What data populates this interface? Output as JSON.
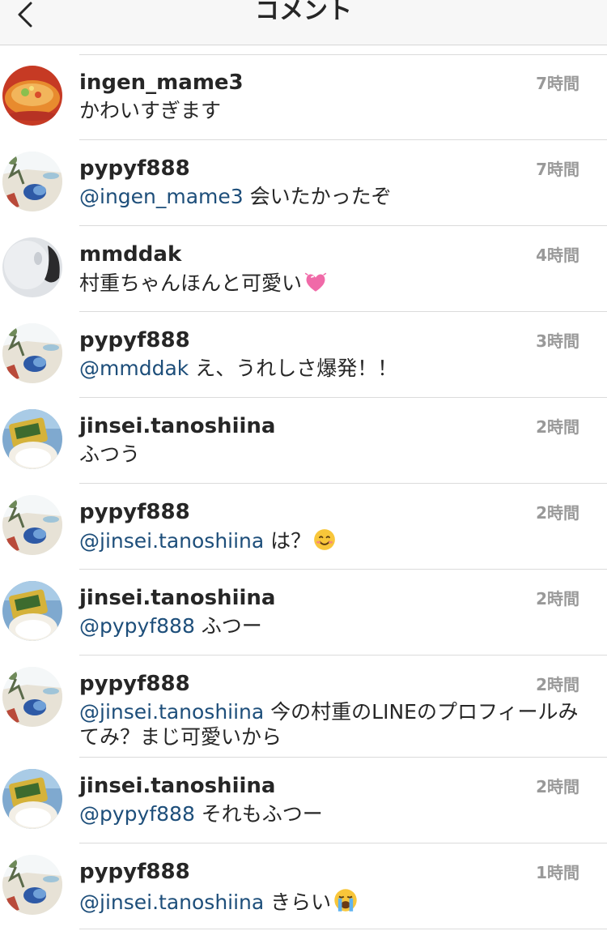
{
  "header": {
    "title": "コメント",
    "back_icon": "chevron-left-icon"
  },
  "comments": [
    {
      "username": "ingen_mame3",
      "time": "7時間",
      "mention": "",
      "text": "かわいすぎます",
      "emoji": "",
      "avatar": "food-photo"
    },
    {
      "username": "pypyf888",
      "time": "7時間",
      "mention": "@ingen_mame3",
      "text": " 会いたかったぞ",
      "emoji": "",
      "avatar": "beach-photo"
    },
    {
      "username": "mmddak",
      "time": "4時間",
      "mention": "",
      "text": "村重ちゃんほんと可愛い",
      "emoji": "sparkling-heart-emoji",
      "avatar": "grey-photo"
    },
    {
      "username": "pypyf888",
      "time": "3時間",
      "mention": "@mmddak",
      "text": " え、うれしさ爆発！！",
      "emoji": "",
      "avatar": "beach-photo"
    },
    {
      "username": "jinsei.tanoshiina",
      "time": "2時間",
      "mention": "",
      "text": "ふつう",
      "emoji": "",
      "avatar": "snack-photo"
    },
    {
      "username": "pypyf888",
      "time": "2時間",
      "mention": "@jinsei.tanoshiina",
      "text": " は？",
      "emoji": "smiling-face-emoji",
      "avatar": "beach-photo"
    },
    {
      "username": "jinsei.tanoshiina",
      "time": "2時間",
      "mention": "@pypyf888",
      "text": " ふつー",
      "emoji": "",
      "avatar": "snack-photo"
    },
    {
      "username": "pypyf888",
      "time": "2時間",
      "mention": "@jinsei.tanoshiina",
      "text": " 今の村重のLINEのプロフィールみてみ？まじ可愛いから",
      "emoji": "",
      "avatar": "beach-photo"
    },
    {
      "username": "jinsei.tanoshiina",
      "time": "2時間",
      "mention": "@pypyf888",
      "text": " それもふつー",
      "emoji": "",
      "avatar": "snack-photo"
    },
    {
      "username": "pypyf888",
      "time": "1時間",
      "mention": "@jinsei.tanoshiina",
      "text": " きらい",
      "emoji": "loudly-crying-face-emoji",
      "avatar": "beach-photo"
    }
  ],
  "colors": {
    "mention": "#1d4e7a",
    "timestamp": "#999999",
    "separator": "#dbdbdb"
  }
}
